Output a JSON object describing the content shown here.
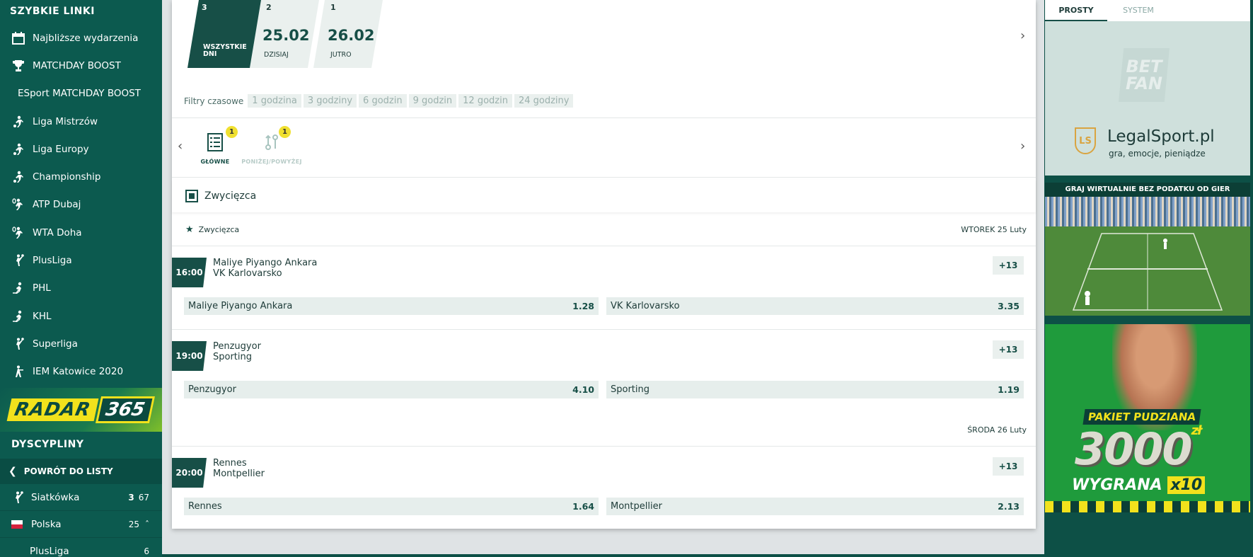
{
  "sidebar": {
    "quick_links_title": "SZYBKIE LINKI",
    "items": [
      {
        "label": "Najbliższe wydarzenia",
        "icon": "calendar-icon"
      },
      {
        "label": "MATCHDAY BOOST",
        "icon": "trophy-icon"
      },
      {
        "label": "ESport MATCHDAY BOOST",
        "icon": ""
      },
      {
        "label": "Liga Mistrzów",
        "icon": "soccer-player-icon"
      },
      {
        "label": "Liga Europy",
        "icon": "soccer-player-icon"
      },
      {
        "label": "Championship",
        "icon": "soccer-player-icon"
      },
      {
        "label": "ATP Dubaj",
        "icon": "tennis-player-icon"
      },
      {
        "label": "WTA Doha",
        "icon": "tennis-player-icon"
      },
      {
        "label": "PlusLiga",
        "icon": "volleyball-player-icon"
      },
      {
        "label": "PHL",
        "icon": "hockey-player-icon"
      },
      {
        "label": "KHL",
        "icon": "hockey-player-icon"
      },
      {
        "label": "Superliga",
        "icon": "volleyball-player-icon"
      },
      {
        "label": "IEM Katowice 2020",
        "icon": "esport-player-icon"
      }
    ],
    "radar_a": "RADAR",
    "radar_b": "365",
    "disciplines_title": "DYSCYPLINY",
    "back_label": "POWRÓT DO LISTY",
    "disciplines": [
      {
        "label": "Siatkówka",
        "live": "3",
        "count": "67"
      },
      {
        "label": "Polska",
        "count": "25"
      },
      {
        "label": "PlusLiga",
        "count": "6"
      }
    ]
  },
  "days": [
    {
      "num": "3",
      "label": "WSZYSTKIE DNI",
      "active": true
    },
    {
      "num": "2",
      "date": "25.02",
      "label": "DZISIAJ"
    },
    {
      "num": "1",
      "date": "26.02",
      "label": "JUTRO"
    }
  ],
  "filters": {
    "label": "Filtry czasowe",
    "chips": [
      "1 godzina",
      "3 godziny",
      "6 godzin",
      "9 godzin",
      "12 godzin",
      "24 godziny"
    ]
  },
  "market_tabs": [
    {
      "label": "GŁÓWNE",
      "badge": "1",
      "active": true
    },
    {
      "label": "PONIŻEJ/POWYŻEJ",
      "badge": "1",
      "active": false
    }
  ],
  "market_title": "Zwycięzca",
  "section_label": "Zwycięzca",
  "dates": [
    "WTOREK 25 Luty",
    "ŚRODA 26 Luty"
  ],
  "events": [
    {
      "time": "16:00",
      "home": "Maliye Piyango Ankara",
      "away": "VK Karlovarsko",
      "more": "+13",
      "odd_home": "1.28",
      "odd_away": "3.35"
    },
    {
      "time": "19:00",
      "home": "Penzugyor",
      "away": "Sporting",
      "more": "+13",
      "odd_home": "4.10",
      "odd_away": "1.19"
    },
    {
      "time": "20:00",
      "home": "Rennes",
      "away": "Montpellier",
      "more": "+13",
      "odd_home": "1.64",
      "odd_away": "2.13"
    }
  ],
  "betslip": {
    "tab_simple": "PROSTY",
    "tab_system": "SYSTEM"
  },
  "ads": {
    "betfan_logo_line1": "BET",
    "betfan_logo_line2": "FAN",
    "legalsport_badge": "LS",
    "legalsport_name": "LegalSport.pl",
    "legalsport_tagline": "gra, emocje, pieniądze",
    "virtual_banner": "GRAJ WIRTUALNIE BEZ PODATKU OD GIER",
    "promo_line1": "PAKIET PUDZIANA",
    "promo_amount": "3000",
    "promo_currency": "zł",
    "promo_line2": "WYGRANA",
    "promo_mult": "x10"
  },
  "colors": {
    "brand_dark": "#0c5a4f",
    "accent_yellow": "#f2e21c",
    "odds_bg": "#e6eeec"
  }
}
